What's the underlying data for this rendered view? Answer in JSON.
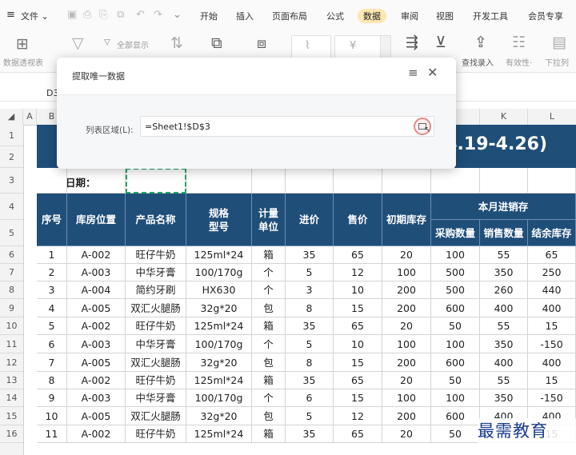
{
  "menubar": {
    "file_label": "文件",
    "tabs": [
      "开始",
      "插入",
      "页面布局",
      "公式",
      "数据",
      "审阅",
      "视图",
      "开发工具",
      "会员专享"
    ],
    "active_tab": "数据"
  },
  "ribbon": {
    "pivot_label": "数据透视表",
    "show_all_label": "全部显示",
    "find_entry_label": "查找录入",
    "validity_label": "有效性·",
    "dropdown_label": "下拉列"
  },
  "namebox": {
    "value": "D3"
  },
  "columns": [
    "A",
    "B",
    "C",
    "D",
    "E",
    "F",
    "G",
    "H",
    "I",
    "J",
    "K",
    "L"
  ],
  "sheet": {
    "title_fragment": "4.19-4.26)",
    "date_label": "日期：",
    "headers": {
      "seq": "序号",
      "location": "库房位置",
      "product": "产品名称",
      "spec": "规格\n型号",
      "unit": "计量\n单位",
      "buy_price": "进价",
      "sell_price": "售价",
      "opening_stock": "初期库存",
      "group": "本月进销存",
      "purchase_qty": "采购数量",
      "sales_qty": "销售数量",
      "closing_stock": "结余库存"
    },
    "row_numbers": [
      "1",
      "2",
      "3",
      "4",
      "5",
      "6",
      "7",
      "8",
      "9",
      "10",
      "11",
      "12",
      "13",
      "14",
      "15",
      "16"
    ],
    "rows": [
      [
        "1",
        "A-002",
        "旺仔牛奶",
        "125ml*24",
        "箱",
        "35",
        "65",
        "20",
        "100",
        "55",
        "65"
      ],
      [
        "2",
        "A-003",
        "中华牙膏",
        "100/170g",
        "个",
        "5",
        "12",
        "100",
        "500",
        "350",
        "250"
      ],
      [
        "3",
        "A-004",
        "简约牙刷",
        "HX630",
        "个",
        "3",
        "10",
        "200",
        "500",
        "260",
        "440"
      ],
      [
        "4",
        "A-005",
        "双汇火腿肠",
        "32g*20",
        "包",
        "8",
        "15",
        "200",
        "600",
        "400",
        "400"
      ],
      [
        "5",
        "A-002",
        "旺仔牛奶",
        "125ml*24",
        "箱",
        "35",
        "65",
        "20",
        "50",
        "55",
        "15"
      ],
      [
        "6",
        "A-003",
        "中华牙膏",
        "100/170g",
        "个",
        "5",
        "10",
        "100",
        "100",
        "350",
        "-150"
      ],
      [
        "7",
        "A-005",
        "双汇火腿肠",
        "32g*20",
        "包",
        "8",
        "15",
        "200",
        "600",
        "400",
        "400"
      ],
      [
        "8",
        "A-002",
        "旺仔牛奶",
        "125ml*24",
        "箱",
        "35",
        "65",
        "20",
        "50",
        "55",
        "15"
      ],
      [
        "9",
        "A-003",
        "中华牙膏",
        "100/170g",
        "个",
        "6",
        "15",
        "100",
        "100",
        "350",
        "-150"
      ],
      [
        "10",
        "A-005",
        "双汇火腿肠",
        "32g*20",
        "包",
        "5",
        "12",
        "200",
        "600",
        "400",
        "400"
      ],
      [
        "11",
        "A-002",
        "旺仔牛奶",
        "125ml*24",
        "箱",
        "35",
        "65",
        "20",
        "50",
        "55",
        "15"
      ]
    ]
  },
  "dialog": {
    "title": "提取唯一数据",
    "field_label": "列表区域(L):",
    "field_value": "=Sheet1!$D$3"
  },
  "watermark": "最需教育"
}
